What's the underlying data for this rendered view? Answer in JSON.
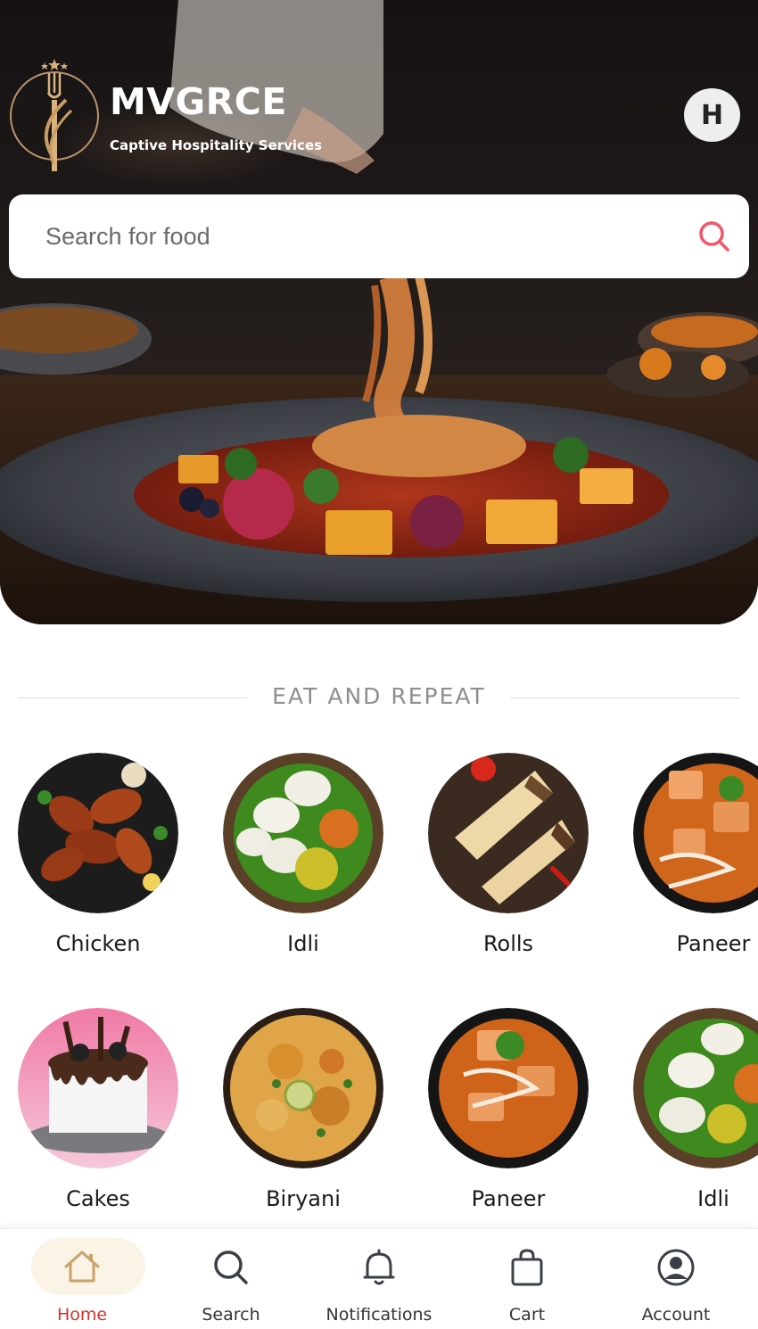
{
  "header": {
    "brand_title": "MVGRCE",
    "brand_subtitle": "Captive Hospitality Services",
    "avatar_initial": "H"
  },
  "search": {
    "placeholder": "Search for food",
    "icon": "search-icon",
    "icon_color": "#f0566a"
  },
  "section": {
    "title": "EAT AND REPEAT"
  },
  "categories": [
    {
      "label": "Chicken",
      "icon": "chicken-image"
    },
    {
      "label": "Idli",
      "icon": "idli-image"
    },
    {
      "label": "Rolls",
      "icon": "rolls-image"
    },
    {
      "label": "Paneer",
      "icon": "paneer-image"
    },
    {
      "label": "Cakes",
      "icon": "cake-image"
    },
    {
      "label": "Biryani",
      "icon": "biryani-image"
    },
    {
      "label": "Paneer",
      "icon": "paneer-image"
    },
    {
      "label": "Idli",
      "icon": "idli-image"
    }
  ],
  "nav": {
    "active_color": "#d8312a",
    "active_bg": "#faf3e6",
    "items": [
      {
        "label": "Home",
        "icon": "home-icon",
        "active": true
      },
      {
        "label": "Search",
        "icon": "search-icon",
        "active": false
      },
      {
        "label": "Notifications",
        "icon": "bell-icon",
        "active": false
      },
      {
        "label": "Cart",
        "icon": "shopping-bag-icon",
        "active": false
      },
      {
        "label": "Account",
        "icon": "user-circle-icon",
        "active": false
      }
    ]
  }
}
